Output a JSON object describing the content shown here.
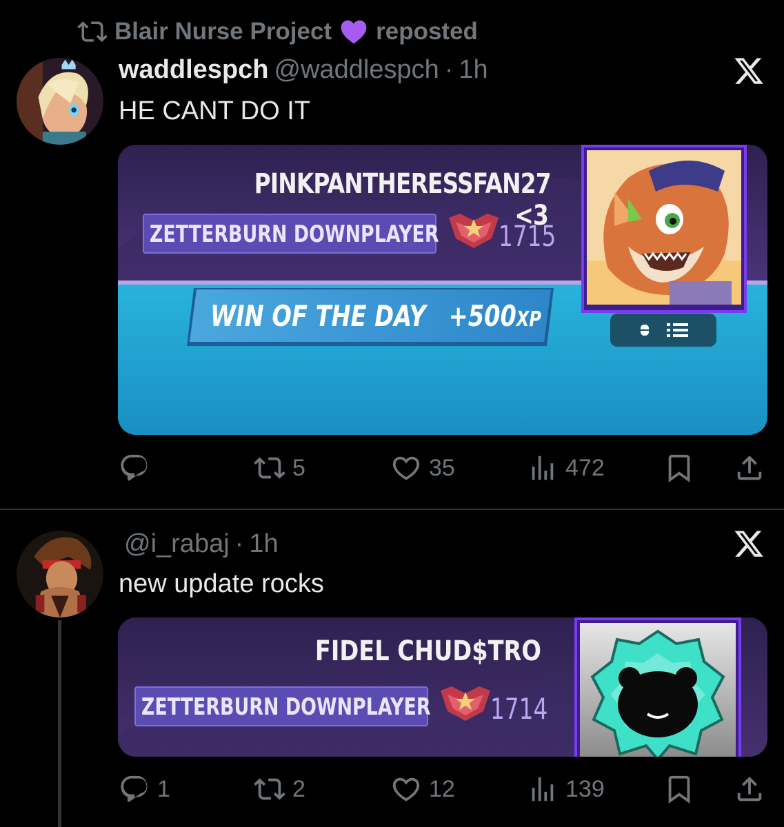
{
  "repost_banner": {
    "user": "Blair Nurse Project",
    "suffix": "reposted"
  },
  "tweets": [
    {
      "display_name": "waddlespch",
      "handle": "@waddlespch",
      "time": "1h",
      "text": "HE CANT DO IT",
      "card": {
        "player_name": "PINKPANTHERESSFAN27 <3",
        "title": "ZETTERBURN DOWNPLAYER",
        "rating": "1715",
        "banner_text": "WIN OF THE DAY",
        "xp_text": "+500",
        "xp_unit": "XP"
      },
      "stats": {
        "replies": "",
        "reposts": "5",
        "likes": "35",
        "views": "472"
      }
    },
    {
      "display_name": "",
      "handle": "@i_rabaj",
      "time": "1h",
      "text": "new update rocks",
      "card": {
        "player_name": "FIDEL CHUD$TRO",
        "title": "ZETTERBURN DOWNPLAYER",
        "rating": "1714"
      },
      "stats": {
        "replies": "1",
        "reposts": "2",
        "likes": "12",
        "views": "139"
      }
    }
  ],
  "icons": {
    "repost": "repost-icon",
    "heart_emoji": "purple-heart-emoji",
    "x_logo": "x-logo-icon",
    "reply": "reply-icon",
    "like": "heart-icon",
    "views": "views-icon",
    "bookmark": "bookmark-icon",
    "share": "share-icon",
    "rank": "rank-emblem-icon"
  },
  "colors": {
    "background": "#000000",
    "muted_text": "#71767b",
    "card_purple": "#3e2b66",
    "card_cyan": "#1fa6d3",
    "badge_purple": "#5a4bb3",
    "frame_purple": "#6a2bd9",
    "heart_purple": "#a65cf0"
  }
}
